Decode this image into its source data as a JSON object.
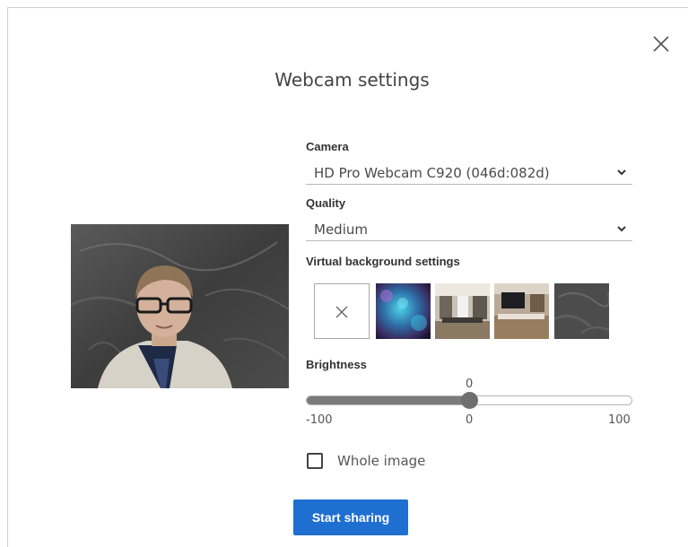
{
  "dialog": {
    "title": "Webcam settings",
    "close_icon": "close-icon"
  },
  "camera": {
    "label": "Camera",
    "selected": "HD Pro Webcam C920 (046d:082d)"
  },
  "quality": {
    "label": "Quality",
    "selected": "Medium"
  },
  "virtual_background": {
    "label": "Virtual background settings",
    "options": [
      {
        "name": "none",
        "icon": "close-icon"
      },
      {
        "name": "blue-bokeh"
      },
      {
        "name": "office"
      },
      {
        "name": "conference-room"
      },
      {
        "name": "dark-texture"
      }
    ]
  },
  "brightness": {
    "label": "Brightness",
    "value": 0,
    "value_text": "0",
    "min": -100,
    "max": 100,
    "min_text": "-100",
    "mid_text": "0",
    "max_text": "100"
  },
  "whole_image": {
    "label": "Whole image",
    "checked": false
  },
  "actions": {
    "start_label": "Start sharing"
  },
  "colors": {
    "primary": "#1f6fd1",
    "slider_fill": "#7b7b7b"
  }
}
